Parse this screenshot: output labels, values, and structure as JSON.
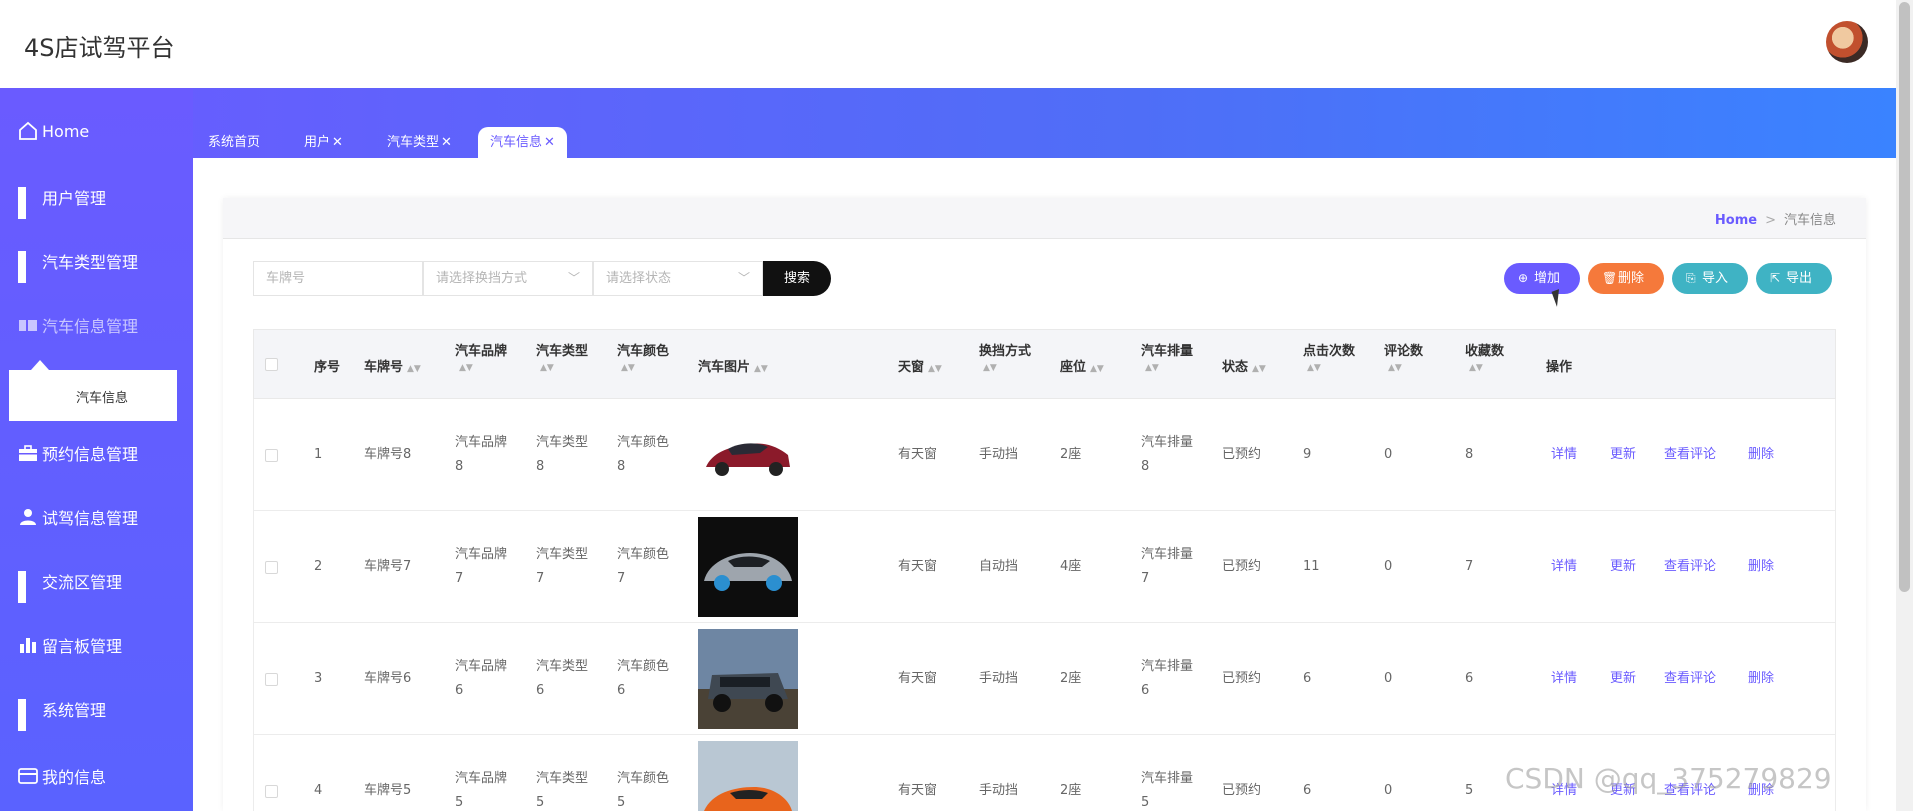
{
  "header": {
    "title": "4S店试驾平台"
  },
  "sidebar": {
    "items": [
      {
        "label": "Home",
        "icon": "home-icon"
      },
      {
        "label": "用户管理",
        "icon": "grid-icon"
      },
      {
        "label": "汽车类型管理",
        "icon": "grid-icon"
      },
      {
        "label": "汽车信息管理",
        "icon": "ticket-icon"
      },
      {
        "label": "预约信息管理",
        "icon": "briefcase-icon"
      },
      {
        "label": "试驾信息管理",
        "icon": "user-icon"
      },
      {
        "label": "交流区管理",
        "icon": "grid-icon"
      },
      {
        "label": "留言板管理",
        "icon": "bar-chart-icon"
      },
      {
        "label": "系统管理",
        "icon": "grid-icon"
      },
      {
        "label": "我的信息",
        "icon": "card-icon"
      }
    ],
    "submenu": {
      "label": "汽车信息"
    }
  },
  "tabs": [
    {
      "label": "系统首页",
      "closable": false
    },
    {
      "label": "用户",
      "closable": true
    },
    {
      "label": "汽车类型",
      "closable": true
    },
    {
      "label": "汽车信息",
      "closable": true,
      "active": true
    }
  ],
  "breadcrumb": {
    "home": "Home",
    "sep": ">",
    "current": "汽车信息"
  },
  "search": {
    "plate_placeholder": "车牌号",
    "gear_placeholder": "请选择换挡方式",
    "status_placeholder": "请选择状态",
    "button": "搜索"
  },
  "actions": {
    "add": "增加",
    "delete": "删除",
    "import": "导入",
    "export": "导出"
  },
  "colors": {
    "primary": "#6a5bff",
    "delete": "#f5793b",
    "teal": "#3fb3c4"
  },
  "table": {
    "columns": [
      "序号",
      "车牌号",
      "汽车品牌",
      "汽车类型",
      "汽车颜色",
      "汽车图片",
      "天窗",
      "换挡方式",
      "座位",
      "汽车排量",
      "状态",
      "点击次数",
      "评论数",
      "收藏数",
      "操作"
    ],
    "row_actions": [
      "详情",
      "更新",
      "查看评论",
      "删除"
    ],
    "rows": [
      {
        "idx": "1",
        "plate": "车牌号8",
        "brand": [
          "汽车品牌",
          "8"
        ],
        "type": [
          "汽车类型",
          "8"
        ],
        "color": [
          "汽车颜色",
          "8"
        ],
        "sunroof": "有天窗",
        "gear": "手动挡",
        "seats": "2座",
        "disp": [
          "汽车排量",
          "8"
        ],
        "status": "已预约",
        "clicks": "9",
        "comments": "0",
        "favs": "8",
        "img": "red-sedan"
      },
      {
        "idx": "2",
        "plate": "车牌号7",
        "brand": [
          "汽车品牌",
          "7"
        ],
        "type": [
          "汽车类型",
          "7"
        ],
        "color": [
          "汽车颜色",
          "7"
        ],
        "sunroof": "有天窗",
        "gear": "自动挡",
        "seats": "4座",
        "disp": [
          "汽车排量",
          "7"
        ],
        "status": "已预约",
        "clicks": "11",
        "comments": "0",
        "favs": "7",
        "img": "silver-sportscar"
      },
      {
        "idx": "3",
        "plate": "车牌号6",
        "brand": [
          "汽车品牌",
          "6"
        ],
        "type": [
          "汽车类型",
          "6"
        ],
        "color": [
          "汽车颜色",
          "6"
        ],
        "sunroof": "有天窗",
        "gear": "手动挡",
        "seats": "2座",
        "disp": [
          "汽车排量",
          "6"
        ],
        "status": "已预约",
        "clicks": "6",
        "comments": "0",
        "favs": "6",
        "img": "offroad-suv"
      },
      {
        "idx": "4",
        "plate": "车牌号5",
        "brand": [
          "汽车品牌",
          "5"
        ],
        "type": [
          "汽车类型",
          "5"
        ],
        "color": [
          "汽车颜色",
          "5"
        ],
        "sunroof": "有天窗",
        "gear": "手动挡",
        "seats": "2座",
        "disp": [
          "汽车排量",
          "5"
        ],
        "status": "已预约",
        "clicks": "6",
        "comments": "0",
        "favs": "5",
        "img": "orange-sportscar"
      }
    ]
  },
  "watermark": "CSDN @qq_375279829"
}
